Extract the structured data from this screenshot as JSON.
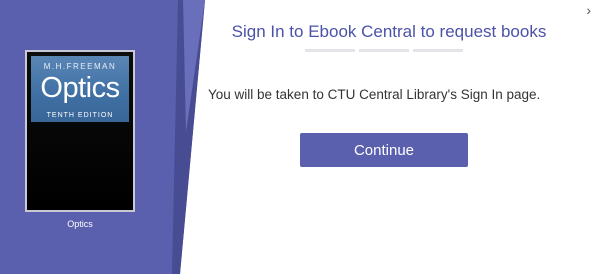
{
  "book": {
    "author": "M.H.FREEMAN",
    "cover_title": "Optics",
    "edition": "TENTH EDITION",
    "caption": "Optics"
  },
  "dialog": {
    "heading": "Sign In to Ebook Central to request books",
    "message": "You will be taken to CTU Central Library's Sign In page.",
    "continue_label": "Continue",
    "close_icon": "chevron-right-icon",
    "close_glyph": "›"
  },
  "colors": {
    "panel": "#5a5fae",
    "panel_dark": "#474c93",
    "accent": "#4b52a8",
    "button": "#5a5fae"
  }
}
